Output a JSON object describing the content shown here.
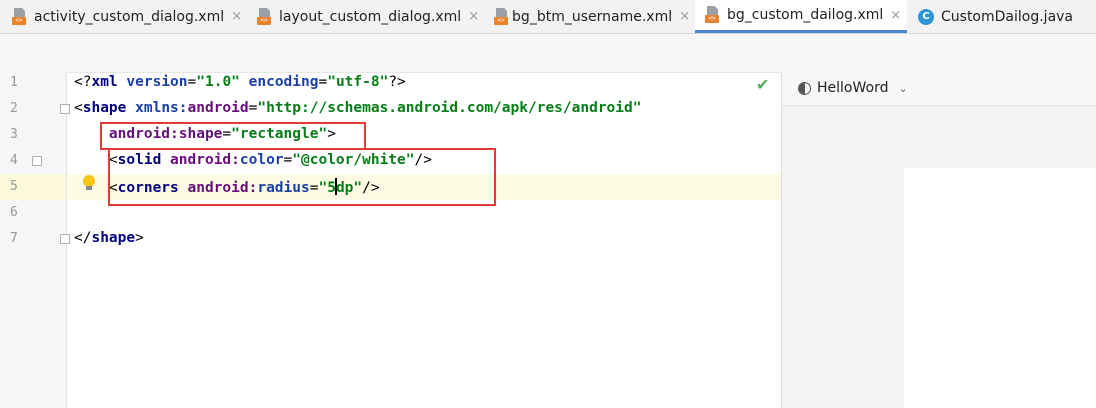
{
  "tabs": [
    {
      "label": "activity_custom_dialog.xml",
      "type": "xml",
      "active": false
    },
    {
      "label": "layout_custom_dialog.xml",
      "type": "xml",
      "active": false
    },
    {
      "label": "bg_btm_username.xml",
      "type": "xml",
      "active": false
    },
    {
      "label": "bg_custom_dailog.xml",
      "type": "xml",
      "active": true
    },
    {
      "label": "CustomDailog.java",
      "type": "java",
      "active": false
    }
  ],
  "tab_close_glyph": "×",
  "file_badge_text": "<>",
  "java_badge_text": "C",
  "editor": {
    "line_numbers": [
      "1",
      "2",
      "3",
      "4",
      "5",
      "6",
      "7"
    ],
    "current_line": "5",
    "lines": {
      "l1": {
        "open": "<?",
        "tag": "xml",
        "a1": "version",
        "eq1": "=",
        "v1": "\"1.0\"",
        "a2": "encoding",
        "eq2": "=",
        "v2": "\"utf-8\"",
        "close": "?>"
      },
      "l2": {
        "open": "<",
        "tag": "shape",
        "ns": "xmlns:",
        "attr": "android",
        "eq": "=",
        "val": "\"http://schemas.android.com/apk/res/android\""
      },
      "l3": {
        "ns": "android:",
        "attr": "shape",
        "eq": "=",
        "val": "\"rectangle\"",
        "close": ">"
      },
      "l4": {
        "open": "<",
        "tag": "solid",
        "ns": "android:",
        "attr": "color",
        "eq": "=",
        "val": "\"@color/white\"",
        "close": "/>"
      },
      "l5": {
        "open": "<",
        "tag": "corners",
        "ns": "android:",
        "attr": "radius",
        "eq": "=",
        "val_before_caret": "\"5",
        "val_after_caret": "dp\"",
        "close": "/>"
      },
      "l7": {
        "open": "</",
        "tag": "shape",
        "close": ">"
      }
    },
    "status_icon": "check-icon",
    "status_glyph": "✔"
  },
  "preview_panel": {
    "device_label": "HelloWord",
    "dropdown_glyph": "⌄"
  },
  "colors": {
    "tag": "#000080",
    "attribute": "#660e7a",
    "string": "#067d17",
    "highlight_box": "#e53935",
    "active_tab_underline": "#4a88c7",
    "current_line_bg": "#fdfbe3"
  }
}
